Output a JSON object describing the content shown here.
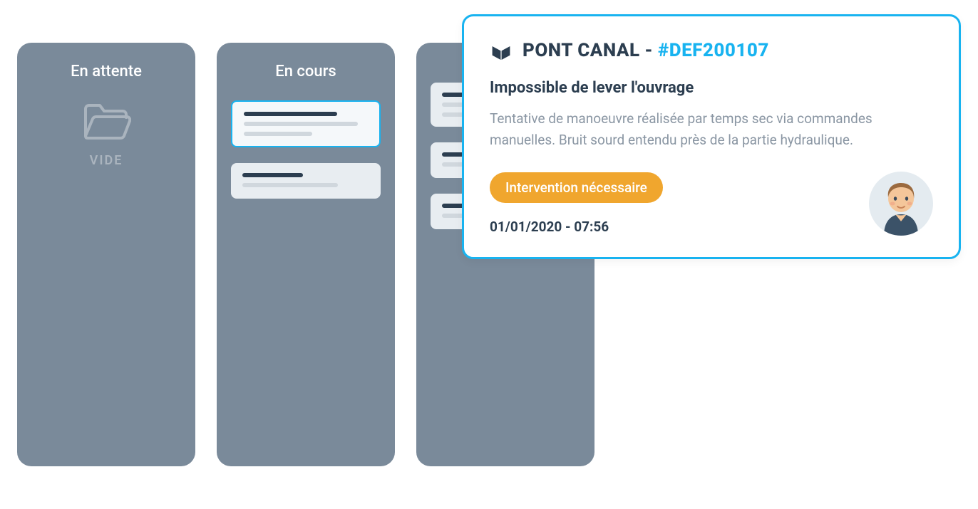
{
  "columns": [
    {
      "title": "En attente",
      "empty": true,
      "empty_label": "VIDE",
      "cards": []
    },
    {
      "title": "En cours",
      "empty": false,
      "cards": [
        {
          "selected": true,
          "lines": 3
        },
        {
          "selected": false,
          "lines": 2
        }
      ]
    },
    {
      "title": "",
      "empty": false,
      "cards": [
        {
          "selected": false,
          "lines": 3
        },
        {
          "selected": false,
          "lines": 2
        },
        {
          "selected": false,
          "lines": 2
        }
      ]
    }
  ],
  "detail": {
    "location": "PONT CANAL",
    "separator": " - ",
    "reference": "#DEF200107",
    "subtitle": "Impossible de lever l'ouvrage",
    "description": "Tentative de manoeuvre réalisée par temps sec via commandes manuelles. Bruit sourd entendu près de la partie hydraulique.",
    "badge": "Intervention nécessaire",
    "timestamp": "01/01/2020 - 07:56"
  }
}
